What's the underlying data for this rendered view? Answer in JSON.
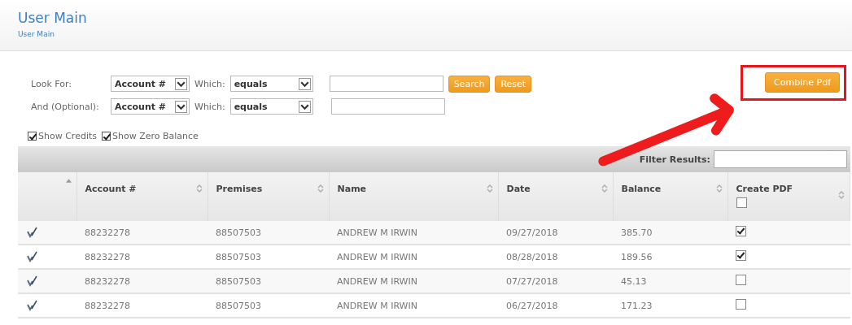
{
  "header": {
    "title": "User Main",
    "breadcrumb": "User Main"
  },
  "filters": [
    {
      "label": "Look For:",
      "field": "Account #",
      "which_label": "Which:",
      "operator": "equals",
      "buttons": [
        "Search",
        "Reset"
      ]
    },
    {
      "label": "And (Optional):",
      "field": "Account #",
      "which_label": "Which:",
      "operator": "equals"
    }
  ],
  "combine_button": "Combine Pdf",
  "options": [
    {
      "label": "Show Credits",
      "checked": true
    },
    {
      "label": "Show Zero Balance",
      "checked": true
    }
  ],
  "filter_results": {
    "label": "Filter Results:"
  },
  "table": {
    "columns": [
      {
        "sorted": true
      },
      {
        "label": "Account #",
        "sorted": false
      },
      {
        "label": "Premises",
        "sorted": false
      },
      {
        "label": "Name",
        "sorted": false
      },
      {
        "label": "Date",
        "sorted": false
      },
      {
        "label": "Balance",
        "sorted": false
      },
      {
        "label": "Create PDF",
        "sorted": false
      }
    ],
    "select_all_checked": false,
    "rows": [
      {
        "account": "88232278",
        "premises": "88507503",
        "name": "ANDREW M IRWIN",
        "date": "09/27/2018",
        "balance": "385.70",
        "create_pdf": true
      },
      {
        "account": "88232278",
        "premises": "88507503",
        "name": "ANDREW M IRWIN",
        "date": "08/28/2018",
        "balance": "189.56",
        "create_pdf": true
      },
      {
        "account": "88232278",
        "premises": "88507503",
        "name": "ANDREW M IRWIN",
        "date": "07/27/2018",
        "balance": "45.13",
        "create_pdf": false
      },
      {
        "account": "88232278",
        "premises": "88507503",
        "name": "ANDREW M IRWIN",
        "date": "06/27/2018",
        "balance": "171.23",
        "create_pdf": false
      }
    ]
  }
}
